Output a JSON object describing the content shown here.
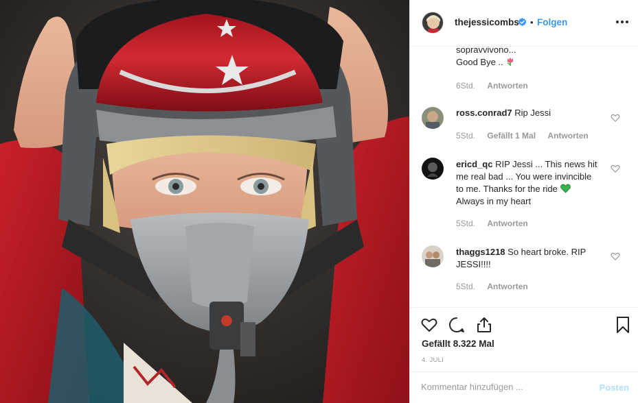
{
  "header": {
    "username": "thejessicombs",
    "separator": "•",
    "follow_label": "Folgen",
    "more_icon": "more-horizontal-icon"
  },
  "comments": [
    {
      "continued_text_1": "sopravvivono...",
      "continued_text_2": "Good Bye ..",
      "emoji": "tulip",
      "time": "6Std.",
      "reply_label": "Antworten"
    },
    {
      "username": "ross.conrad7",
      "text": "Rip Jessi",
      "time": "5Std.",
      "likes_label": "Gefällt 1 Mal",
      "reply_label": "Antworten"
    },
    {
      "username": "ericd_qc",
      "text_line1": "RIP Jessi ... This news hit",
      "text_line2": "me real bad ... You were invincible",
      "text_line3": "to me. Thanks for the ride",
      "text_line4": "Always in my heart",
      "emoji": "green-heart",
      "time": "5Std.",
      "reply_label": "Antworten"
    },
    {
      "username": "thaggs1218",
      "text_line1": "So heart broke. RIP",
      "text_line2": "JESSI!!!!",
      "time": "5Std.",
      "reply_label": "Antworten"
    }
  ],
  "actions": {
    "likes_text": "Gefällt 8.322 Mal",
    "date": "4. JULI"
  },
  "add_comment": {
    "placeholder": "Kommentar hinzufügen ...",
    "post_label": "Posten"
  },
  "colors": {
    "link_blue": "#3897f0",
    "post_disabled": "#b2dffc",
    "muted": "#999999",
    "verified": "#3897f0",
    "green_heart": "#37b24d"
  }
}
